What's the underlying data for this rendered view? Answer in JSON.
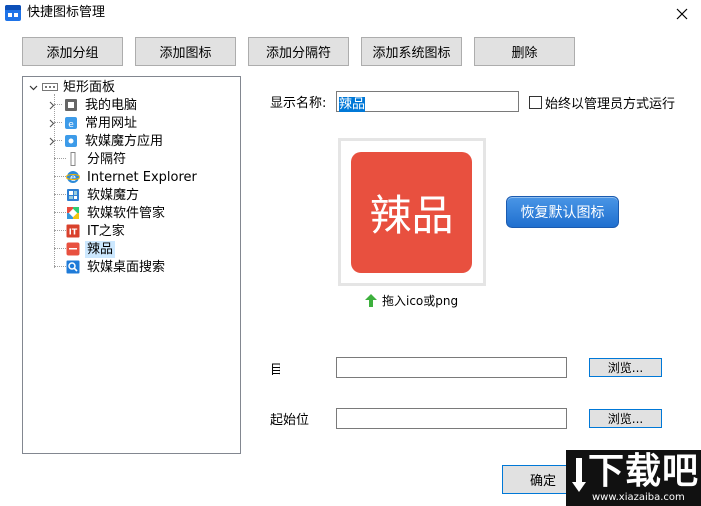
{
  "window": {
    "title": "快捷图标管理"
  },
  "toolbar": {
    "add_group": "添加分组",
    "add_icon": "添加图标",
    "add_separator": "添加分隔符",
    "add_system_icon": "添加系统图标",
    "delete": "删除"
  },
  "tree": {
    "root": "矩形面板",
    "items": [
      {
        "label": "我的电脑",
        "icon": "computer-icon",
        "expandable": true
      },
      {
        "label": "常用网址",
        "icon": "web-icon",
        "expandable": true
      },
      {
        "label": "软媒魔方应用",
        "icon": "app-folder-icon",
        "expandable": true
      },
      {
        "label": "分隔符",
        "icon": "separator-icon",
        "expandable": false
      },
      {
        "label": "Internet Explorer",
        "icon": "ie-icon",
        "expandable": false
      },
      {
        "label": "软媒魔方",
        "icon": "cube-icon",
        "expandable": false
      },
      {
        "label": "软媒软件管家",
        "icon": "software-manager-icon",
        "expandable": false
      },
      {
        "label": "IT之家",
        "icon": "ithome-icon",
        "expandable": false
      },
      {
        "label": "辣品",
        "icon": "lapin-icon",
        "expandable": false,
        "selected": true
      },
      {
        "label": "软媒桌面搜索",
        "icon": "search-icon",
        "expandable": false
      }
    ]
  },
  "form": {
    "name_label": "显示名称:",
    "name_value": "辣品",
    "admin_checkbox_label": "始终以管理员方式运行",
    "admin_checked": false,
    "icon_text": "辣品",
    "restore_label": "恢复默认图标",
    "drag_hint": "拖入ico或png",
    "target_label": "目标",
    "target_value": "",
    "start_label": "起始位",
    "start_value": "",
    "browse_label": "浏览...",
    "ok_label": "确定"
  },
  "watermark": {
    "text": "下载吧",
    "url": "www.xiazaiba.com"
  },
  "colors": {
    "accent": "#0078d7",
    "icon_red": "#e8503f",
    "restore_blue": "#2a7ad6"
  }
}
